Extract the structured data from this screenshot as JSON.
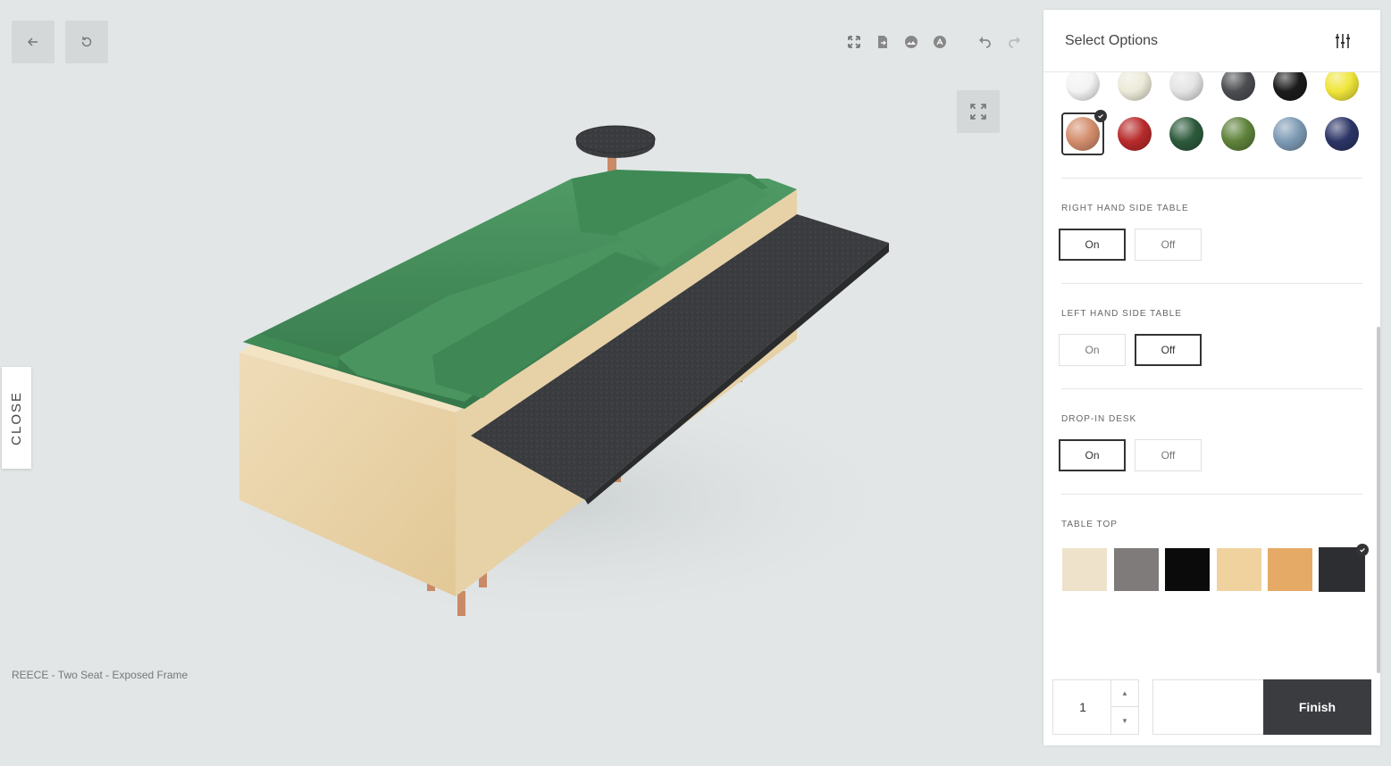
{
  "viewer": {
    "product_name": "REECE - Two Seat - Exposed Frame",
    "close_label": "CLOSE",
    "toolbar_left": [
      "back-arrow-icon",
      "reset-icon"
    ],
    "toolbar_right": [
      "fullscreen-icon",
      "export-file-icon",
      "image-icon",
      "pdf-icon",
      "undo-icon",
      "redo-icon"
    ]
  },
  "panel": {
    "title": "Select Options",
    "filter_icon": "sliders-icon",
    "fabric_swatches_row1": [
      "#f3f3f3",
      "#ecead9",
      "#e4e4e4",
      "#4b4d50",
      "#1b1b1b",
      "#efe53a"
    ],
    "fabric_swatches_row2": [
      "#d38d6c",
      "#b82b2c",
      "#2c5a3b",
      "#5e823b",
      "#7d9ab4",
      "#2c3566"
    ],
    "fabric_selected_index": 0,
    "right_table": {
      "label": "RIGHT HAND SIDE TABLE",
      "on": "On",
      "off": "Off",
      "selected": "On"
    },
    "left_table": {
      "label": "LEFT HAND SIDE TABLE",
      "on": "On",
      "off": "Off",
      "selected": "Off"
    },
    "drop_in_desk": {
      "label": "DROP-IN DESK",
      "on": "On",
      "off": "Off",
      "selected": "On"
    },
    "table_top": {
      "label": "TABLE TOP",
      "swatches": [
        "#eee2ca",
        "#7f7b7b",
        "#0b0b0b",
        "#f0d29e",
        "#e5aa66",
        "#2d2e31"
      ],
      "selected_index": 5
    }
  },
  "footer": {
    "quantity": "1",
    "price": "",
    "finish_label": "Finish"
  }
}
